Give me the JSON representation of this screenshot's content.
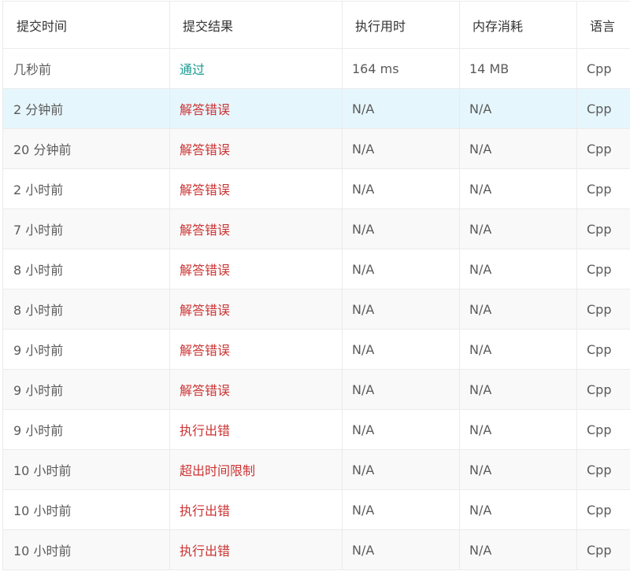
{
  "columns": [
    "提交时间",
    "提交结果",
    "执行用时",
    "内存消耗",
    "语言"
  ],
  "colors": {
    "accepted": "#1a9a91",
    "error": "#cc3333",
    "highlight_row": "#e6f6fd",
    "stripe": "#f9f9f9"
  },
  "submissions": [
    {
      "time": "几秒前",
      "result": "通过",
      "status": "accepted",
      "runtime": "164 ms",
      "memory": "14 MB",
      "lang": "Cpp"
    },
    {
      "time": "2 分钟前",
      "result": "解答错误",
      "status": "error",
      "runtime": "N/A",
      "memory": "N/A",
      "lang": "Cpp"
    },
    {
      "time": "20 分钟前",
      "result": "解答错误",
      "status": "error",
      "runtime": "N/A",
      "memory": "N/A",
      "lang": "Cpp"
    },
    {
      "time": "2 小时前",
      "result": "解答错误",
      "status": "error",
      "runtime": "N/A",
      "memory": "N/A",
      "lang": "Cpp"
    },
    {
      "time": "7 小时前",
      "result": "解答错误",
      "status": "error",
      "runtime": "N/A",
      "memory": "N/A",
      "lang": "Cpp"
    },
    {
      "time": "8 小时前",
      "result": "解答错误",
      "status": "error",
      "runtime": "N/A",
      "memory": "N/A",
      "lang": "Cpp"
    },
    {
      "time": "8 小时前",
      "result": "解答错误",
      "status": "error",
      "runtime": "N/A",
      "memory": "N/A",
      "lang": "Cpp"
    },
    {
      "time": "9 小时前",
      "result": "解答错误",
      "status": "error",
      "runtime": "N/A",
      "memory": "N/A",
      "lang": "Cpp"
    },
    {
      "time": "9 小时前",
      "result": "解答错误",
      "status": "error",
      "runtime": "N/A",
      "memory": "N/A",
      "lang": "Cpp"
    },
    {
      "time": "9 小时前",
      "result": "执行出错",
      "status": "error",
      "runtime": "N/A",
      "memory": "N/A",
      "lang": "Cpp"
    },
    {
      "time": "10 小时前",
      "result": "超出时间限制",
      "status": "error",
      "runtime": "N/A",
      "memory": "N/A",
      "lang": "Cpp"
    },
    {
      "time": "10 小时前",
      "result": "执行出错",
      "status": "error",
      "runtime": "N/A",
      "memory": "N/A",
      "lang": "Cpp"
    },
    {
      "time": "10 小时前",
      "result": "执行出错",
      "status": "error",
      "runtime": "N/A",
      "memory": "N/A",
      "lang": "Cpp"
    }
  ]
}
